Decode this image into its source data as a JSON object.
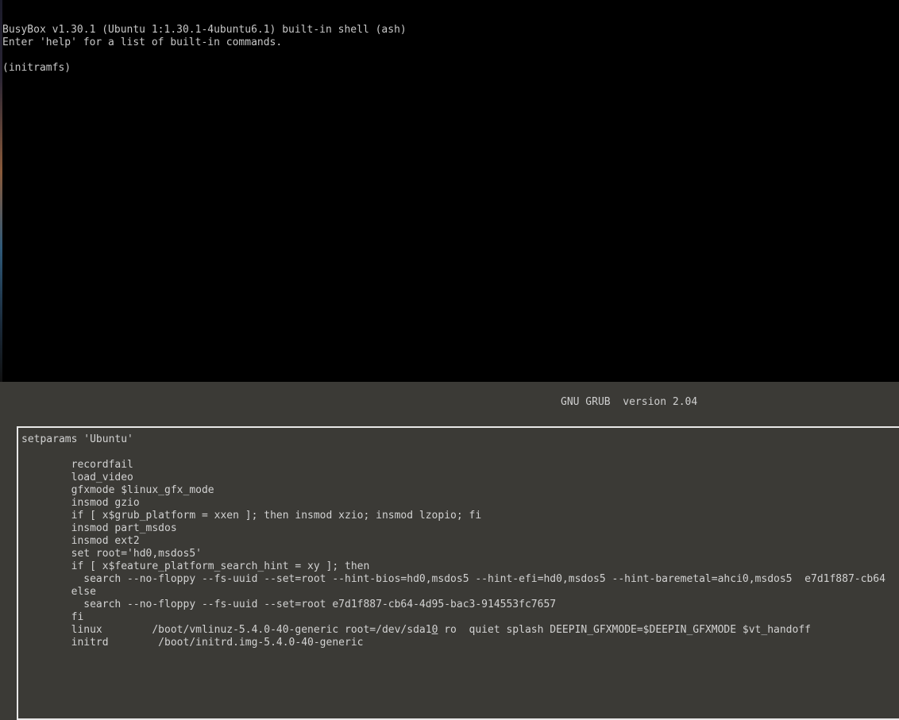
{
  "console": {
    "lines": [
      "BusyBox v1.30.1 (Ubuntu 1:1.30.1-4ubuntu6.1) built-in shell (ash)",
      "Enter 'help' for a list of built-in commands.",
      "",
      "(initramfs)"
    ]
  },
  "grub": {
    "header": "GNU GRUB  version 2.04",
    "editor_lines": [
      "setparams 'Ubuntu'",
      "",
      "        recordfail",
      "        load_video",
      "        gfxmode $linux_gfx_mode",
      "        insmod gzio",
      "        if [ x$grub_platform = xxen ]; then insmod xzio; insmod lzopio; fi",
      "        insmod part_msdos",
      "        insmod ext2",
      "        set root='hd0,msdos5'",
      "        if [ x$feature_platform_search_hint = xy ]; then",
      "          search --no-floppy --fs-uuid --set=root --hint-bios=hd0,msdos5 --hint-efi=hd0,msdos5 --hint-baremetal=ahci0,msdos5  e7d1f887-cb64",
      "        else",
      "          search --no-floppy --fs-uuid --set=root e7d1f887-cb64-4d95-bac3-914553fc7657",
      "        fi"
    ],
    "linux_line": {
      "before_cursor": "        linux        /boot/vmlinuz-5.4.0-40-generic root=/dev/sda1",
      "cursor_char": "0",
      "after_cursor": " ro  quiet splash DEEPIN_GFXMODE=$DEEPIN_GFXMODE $vt_handoff"
    },
    "initrd_line": "        initrd        /boot/initrd.img-5.4.0-40-generic"
  }
}
